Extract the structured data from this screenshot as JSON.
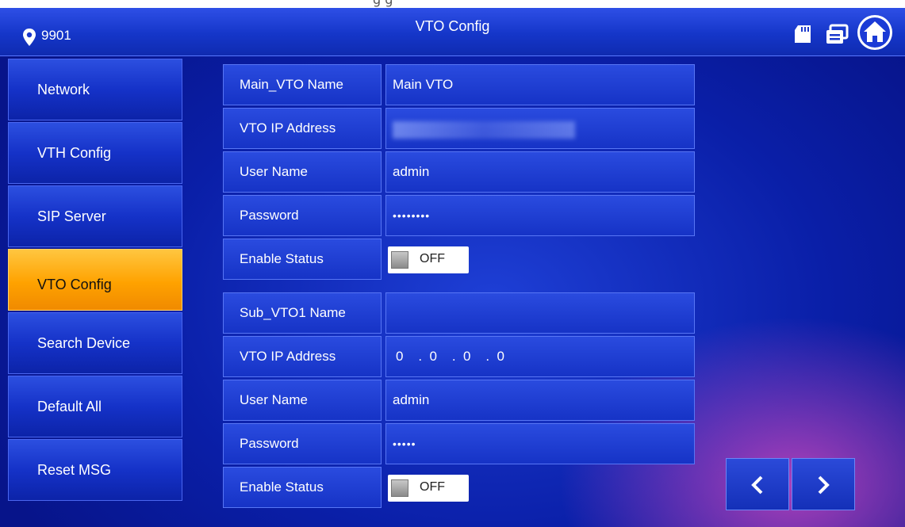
{
  "top_strip_text": "g                    g",
  "header": {
    "location_number": "9901",
    "title": "VTO Config"
  },
  "sidebar": {
    "items": [
      {
        "label": "Network"
      },
      {
        "label": "VTH Config"
      },
      {
        "label": "SIP Server"
      },
      {
        "label": "VTO Config",
        "active": true
      },
      {
        "label": "Search Device"
      },
      {
        "label": "Default All"
      },
      {
        "label": "Reset MSG"
      }
    ]
  },
  "main_vto": {
    "name_label": "Main_VTO Name",
    "name_value": "Main VTO",
    "ip_label": "VTO IP Address",
    "user_label": "User Name",
    "user_value": "admin",
    "password_label": "Password",
    "password_value": "••••••••",
    "enable_label": "Enable Status",
    "enable_state": "OFF"
  },
  "sub_vto1": {
    "name_label": "Sub_VTO1 Name",
    "name_value": "",
    "ip_label": "VTO IP Address",
    "ip_value": "0    .  0    .  0    .  0",
    "user_label": "User Name",
    "user_value": "admin",
    "password_label": "Password",
    "password_value": "•••••",
    "enable_label": "Enable Status",
    "enable_state": "OFF"
  },
  "icons": {
    "location": "location-pin-icon",
    "sd_card": "sd-card-icon",
    "messages": "message-icon",
    "home": "home-icon",
    "prev": "chevron-left-icon",
    "next": "chevron-right-icon"
  },
  "colors": {
    "active_tab": "#ffa200",
    "panel_blue": "#1633c6"
  }
}
